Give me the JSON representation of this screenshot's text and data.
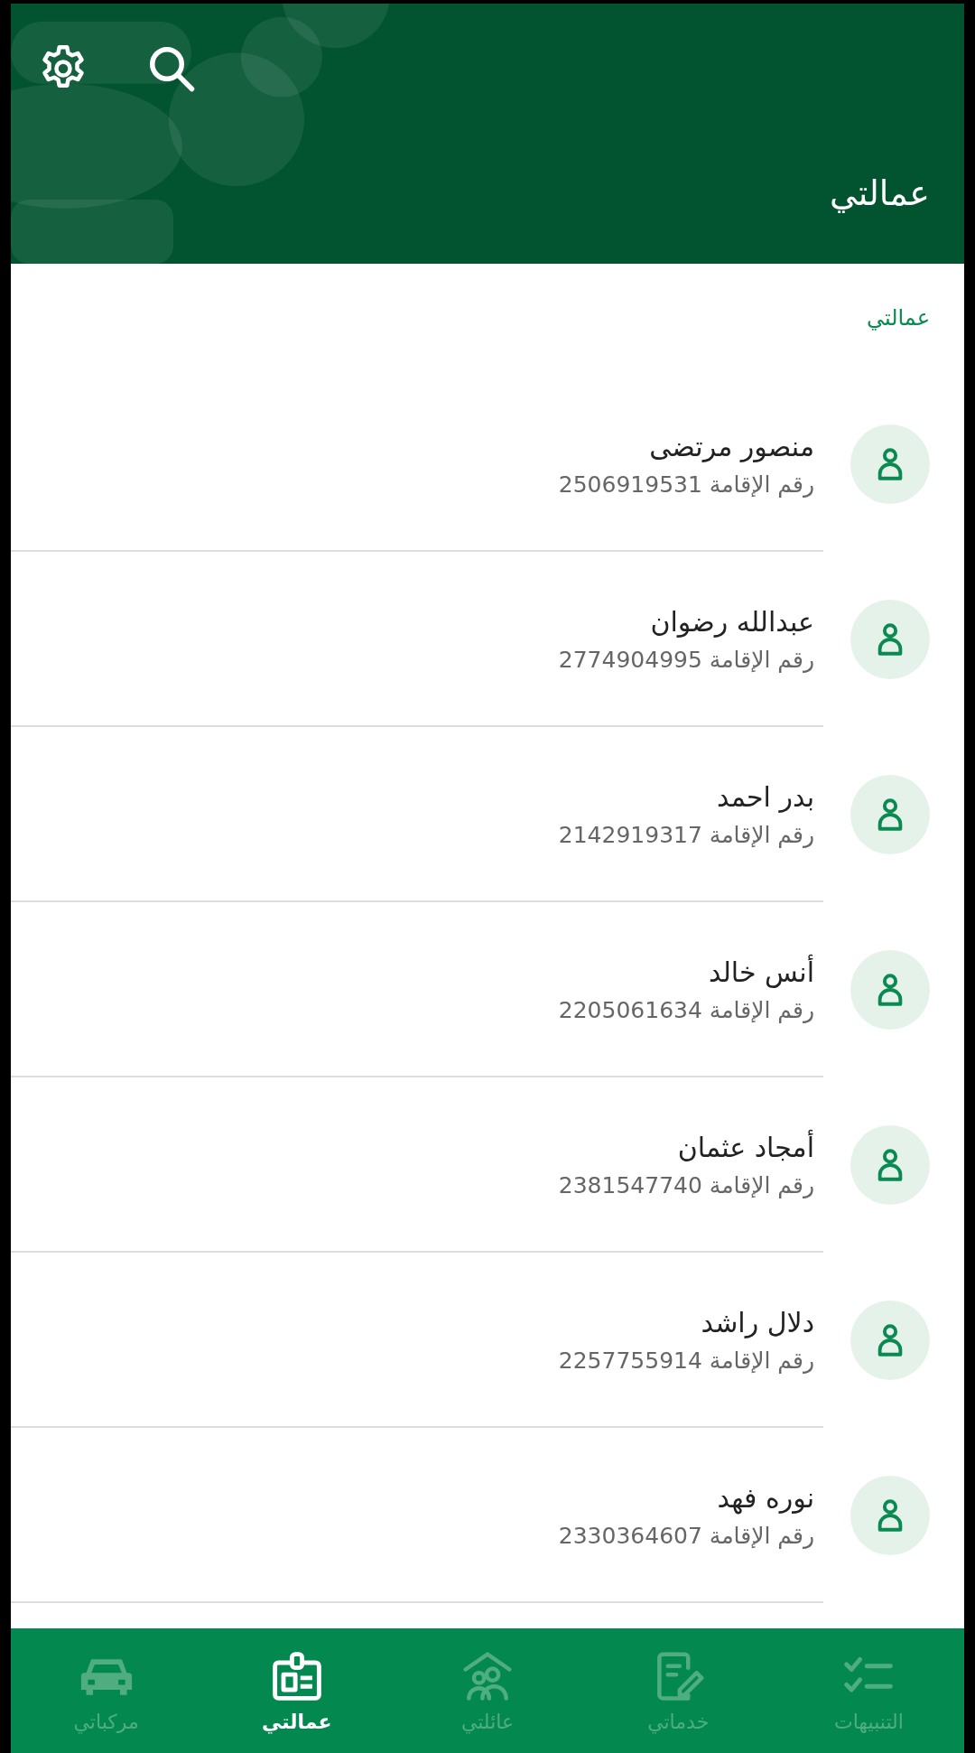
{
  "header": {
    "title": "عمالتي"
  },
  "section_label": "عمالتي",
  "workers": [
    {
      "name": "منصور مرتضى",
      "id_label": "رقم الإقامة",
      "id_number": "2506919531"
    },
    {
      "name": "عبدالله رضوان",
      "id_label": "رقم الإقامة",
      "id_number": "2774904995"
    },
    {
      "name": "بدر احمد",
      "id_label": "رقم الإقامة",
      "id_number": "2142919317"
    },
    {
      "name": "أنس خالد",
      "id_label": "رقم الإقامة",
      "id_number": "2205061634"
    },
    {
      "name": "أمجاد عثمان",
      "id_label": "رقم الإقامة",
      "id_number": "2381547740"
    },
    {
      "name": "دلال راشد",
      "id_label": "رقم الإقامة",
      "id_number": "2257755914"
    },
    {
      "name": "نوره فهد",
      "id_label": "رقم الإقامة",
      "id_number": "2330364607"
    }
  ],
  "bottom_nav": [
    {
      "label": "التنبيهات",
      "selected": false
    },
    {
      "label": "خدماتي",
      "selected": false
    },
    {
      "label": "عائلتي",
      "selected": false
    },
    {
      "label": "عمالتي",
      "selected": true
    },
    {
      "label": "مركباتي",
      "selected": false
    }
  ]
}
